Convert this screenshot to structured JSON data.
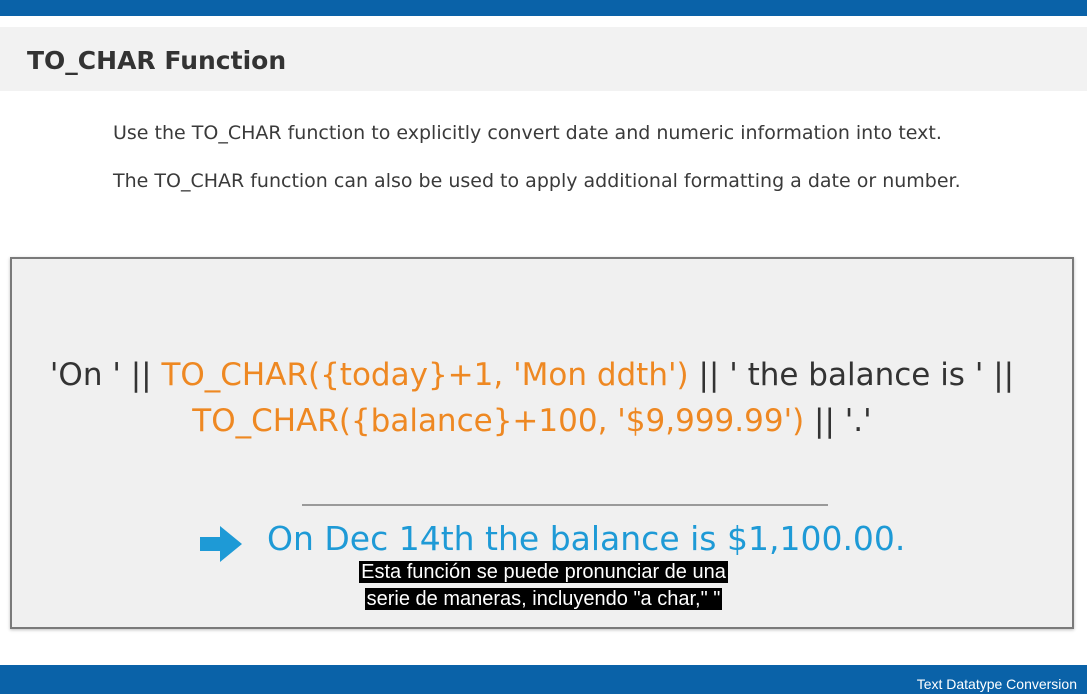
{
  "slide": {
    "title": "TO_CHAR Function",
    "intro": [
      "Use the TO_CHAR function to explicitly convert date and numeric information into text.",
      "The TO_CHAR function can also be used to apply additional formatting a date or number."
    ],
    "example": {
      "line1": [
        {
          "text": "'On ' || ",
          "color": "#333333"
        },
        {
          "text": "TO_CHAR({today}+1, 'Mon ddth')",
          "color": "#ee8822"
        },
        {
          "text": " || ' the balance is ' ||",
          "color": "#333333"
        }
      ],
      "line2": [
        {
          "text": "TO_CHAR({balance}+100, '$9,999.99')",
          "color": "#ee8822"
        },
        {
          "text": " || '.'",
          "color": "#333333"
        }
      ],
      "result_icon": "arrow-right-icon",
      "result_text": "On Dec 14th the balance is $1,100.00."
    },
    "footer_label": "Text Datatype Conversion"
  },
  "subtitles": {
    "line1": "Esta función se puede pronunciar de una",
    "line2": "serie de maneras, incluyendo \"a char,\" \""
  },
  "colors": {
    "brand_blue": "#0a62a8",
    "code_orange": "#ee8822",
    "result_blue": "#1e9ad6"
  }
}
